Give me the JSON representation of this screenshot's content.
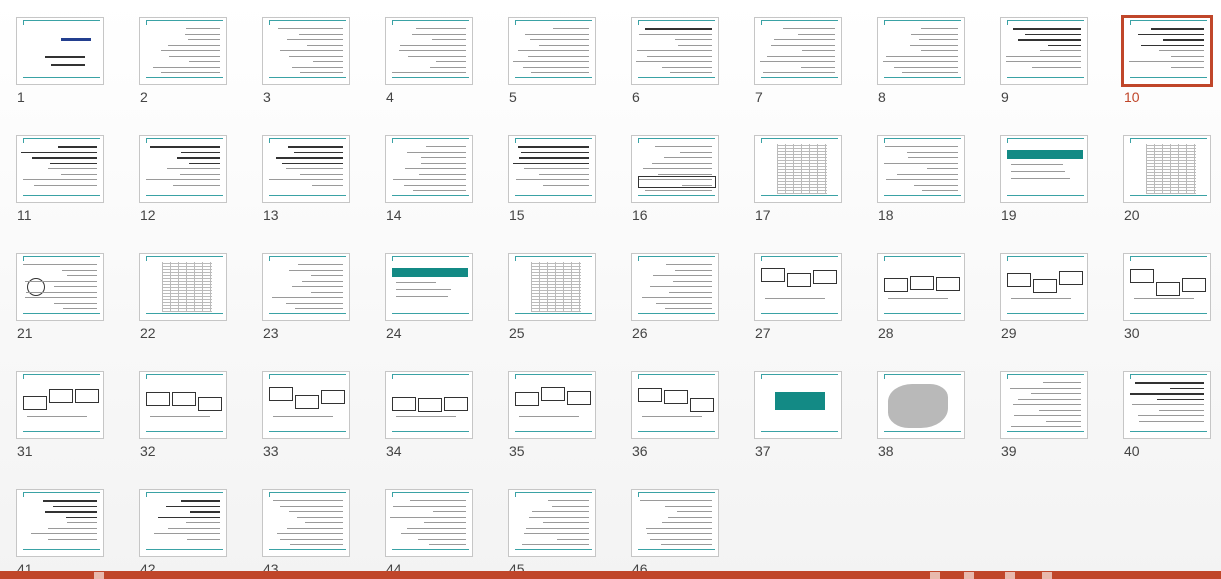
{
  "slides": [
    {
      "number": "1",
      "kind": "title"
    },
    {
      "number": "2",
      "kind": "text"
    },
    {
      "number": "3",
      "kind": "text"
    },
    {
      "number": "4",
      "kind": "text"
    },
    {
      "number": "5",
      "kind": "text"
    },
    {
      "number": "6",
      "kind": "title-text"
    },
    {
      "number": "7",
      "kind": "text"
    },
    {
      "number": "8",
      "kind": "text"
    },
    {
      "number": "9",
      "kind": "bullets"
    },
    {
      "number": "10",
      "kind": "bullets",
      "selected": true
    },
    {
      "number": "11",
      "kind": "bullets"
    },
    {
      "number": "12",
      "kind": "bullets"
    },
    {
      "number": "13",
      "kind": "bullets"
    },
    {
      "number": "14",
      "kind": "text"
    },
    {
      "number": "15",
      "kind": "bullets"
    },
    {
      "number": "16",
      "kind": "table"
    },
    {
      "number": "17",
      "kind": "grid"
    },
    {
      "number": "18",
      "kind": "text"
    },
    {
      "number": "19",
      "kind": "tealtable"
    },
    {
      "number": "20",
      "kind": "grid"
    },
    {
      "number": "21",
      "kind": "diagram"
    },
    {
      "number": "22",
      "kind": "grid"
    },
    {
      "number": "23",
      "kind": "text"
    },
    {
      "number": "24",
      "kind": "tealtable"
    },
    {
      "number": "25",
      "kind": "grid"
    },
    {
      "number": "26",
      "kind": "text"
    },
    {
      "number": "27",
      "kind": "boxes"
    },
    {
      "number": "28",
      "kind": "boxes"
    },
    {
      "number": "29",
      "kind": "boxes"
    },
    {
      "number": "30",
      "kind": "boxes"
    },
    {
      "number": "31",
      "kind": "boxes"
    },
    {
      "number": "32",
      "kind": "boxes"
    },
    {
      "number": "33",
      "kind": "boxes"
    },
    {
      "number": "34",
      "kind": "boxes"
    },
    {
      "number": "35",
      "kind": "boxes"
    },
    {
      "number": "36",
      "kind": "boxes"
    },
    {
      "number": "37",
      "kind": "tealbox"
    },
    {
      "number": "38",
      "kind": "map"
    },
    {
      "number": "39",
      "kind": "text"
    },
    {
      "number": "40",
      "kind": "bullets"
    },
    {
      "number": "41",
      "kind": "bullets"
    },
    {
      "number": "42",
      "kind": "bullets"
    },
    {
      "number": "43",
      "kind": "text"
    },
    {
      "number": "44",
      "kind": "text"
    },
    {
      "number": "45",
      "kind": "text"
    },
    {
      "number": "46",
      "kind": "text"
    }
  ],
  "colors": {
    "accent": "#c0462a",
    "teal": "#138a85",
    "line": "#3aa2a5"
  }
}
